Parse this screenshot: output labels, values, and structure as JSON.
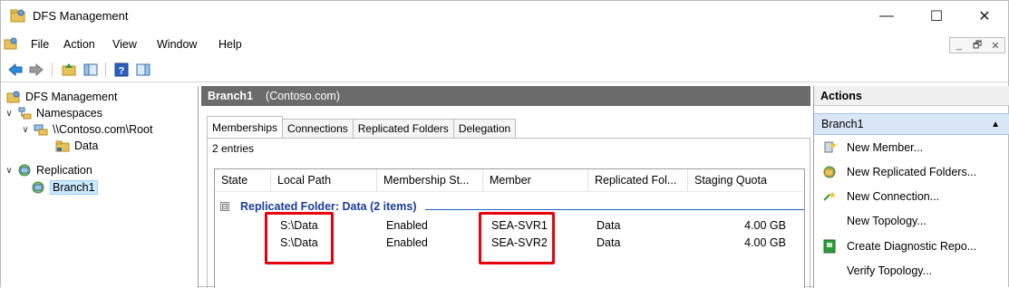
{
  "window": {
    "title": "DFS Management",
    "controls": {
      "minimize": "—",
      "maximize": "☐",
      "close": "✕"
    }
  },
  "menubar": {
    "items": [
      "File",
      "Action",
      "View",
      "Window",
      "Help"
    ],
    "mdi": {
      "minimize": "_",
      "restore": "🗗",
      "close": "✕"
    }
  },
  "tree": {
    "items": [
      {
        "label": "DFS Management",
        "expander": "",
        "icon": "dfs-management-icon"
      },
      {
        "label": "Namespaces",
        "expander": "∨",
        "icon": "namespaces-icon"
      },
      {
        "label": "\\\\Contoso.com\\Root",
        "expander": "∨",
        "icon": "namespace-root-icon"
      },
      {
        "label": "Data",
        "expander": "",
        "icon": "folder-icon"
      },
      {
        "label": "Replication",
        "expander": "∨",
        "icon": "replication-icon"
      },
      {
        "label": "Branch1",
        "expander": "",
        "icon": "replication-group-icon",
        "selected": true
      }
    ]
  },
  "center": {
    "header_title": "Branch1",
    "header_subtitle": "(Contoso.com)",
    "tabs": [
      "Memberships",
      "Connections",
      "Replicated Folders",
      "Delegation"
    ],
    "active_tab": "Memberships",
    "entries_text": "2 entries",
    "columns": [
      "State",
      "Local Path",
      "Membership St...",
      "Member",
      "Replicated Fol...",
      "Staging Quota"
    ],
    "group": {
      "toggle": "⊟",
      "label": "Replicated Folder: Data (2 items)"
    },
    "rows": [
      {
        "state": "",
        "local_path": "S:\\Data",
        "membership_status": "Enabled",
        "member": "SEA-SVR1",
        "replicated_folder": "Data",
        "staging_quota": "4.00 GB"
      },
      {
        "state": "",
        "local_path": "S:\\Data",
        "membership_status": "Enabled",
        "member": "SEA-SVR2",
        "replicated_folder": "Data",
        "staging_quota": "4.00 GB"
      }
    ],
    "highlight_color": "#e8000b"
  },
  "actions": {
    "title": "Actions",
    "section": "Branch1",
    "collapse_glyph": "▲",
    "items": [
      {
        "label": "New Member...",
        "icon": "new-member-icon"
      },
      {
        "label": "New Replicated Folders...",
        "icon": "new-replicated-folders-icon"
      },
      {
        "label": "New Connection...",
        "icon": "new-connection-icon"
      },
      {
        "label": "New Topology...",
        "icon": ""
      },
      {
        "label": "Create Diagnostic Repo...",
        "icon": "diagnostic-report-icon"
      },
      {
        "label": "Verify Topology...",
        "icon": ""
      }
    ]
  },
  "colors": {
    "header_bg": "#6b6b6b",
    "group_text": "#1a3e9c",
    "action_section_bg": "#d9e6f6",
    "selection_bg": "#cce8ff"
  }
}
